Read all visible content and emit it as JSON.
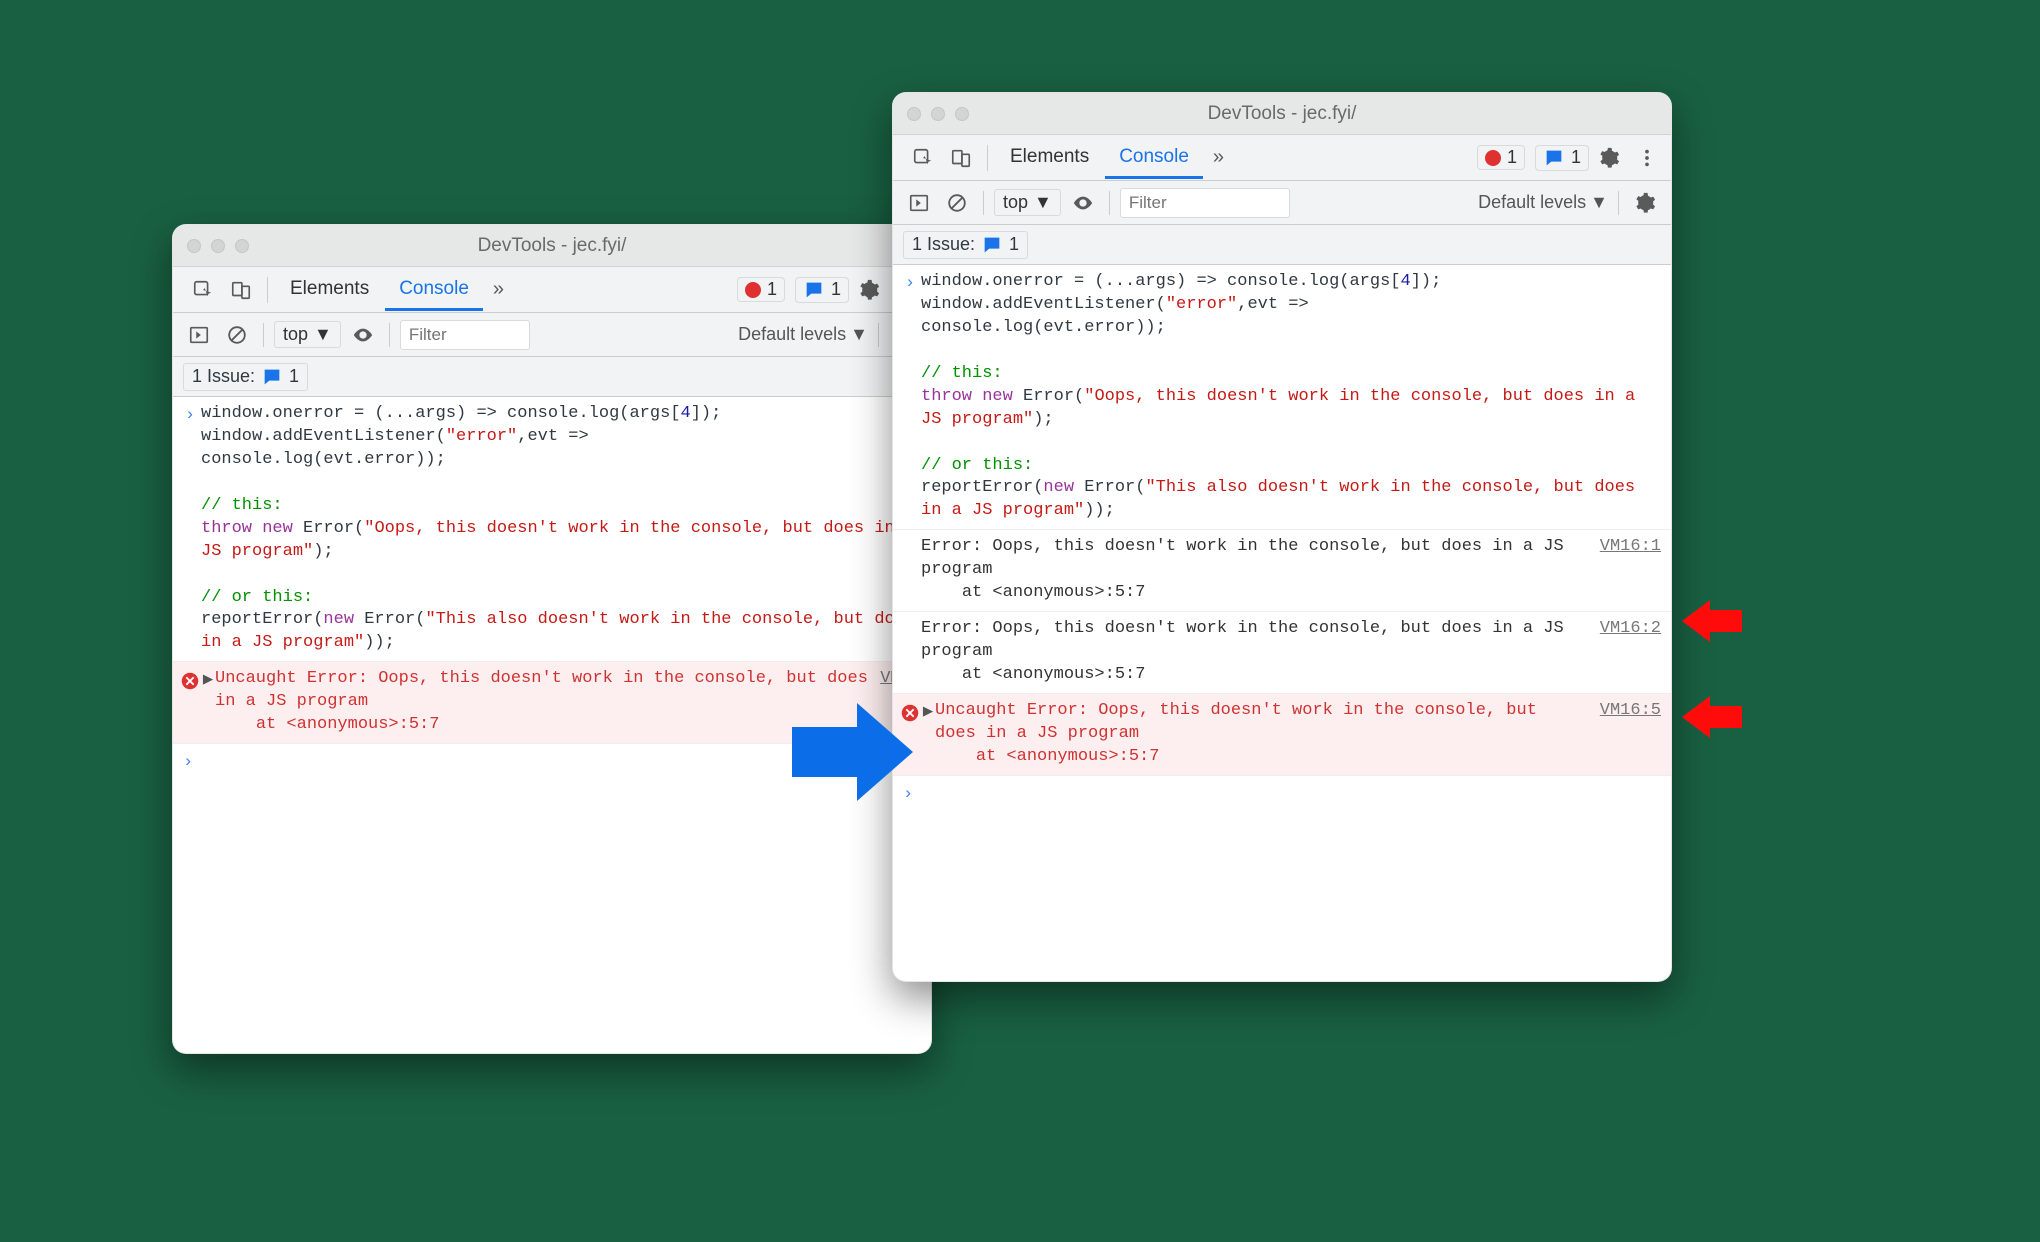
{
  "left": {
    "title": "DevTools - jec.fyi/",
    "tabs": {
      "elements": "Elements",
      "console": "Console"
    },
    "error_count": "1",
    "info_count": "1",
    "toolbar": {
      "context": "top",
      "filter_placeholder": "Filter",
      "levels": "Default levels"
    },
    "issues": {
      "label": "1 Issue:",
      "count": "1"
    },
    "input_code": {
      "l1a": "window.onerror = (...args) => console.log(args[",
      "l1b": "4",
      "l1c": "]);",
      "l2a": "window.addEventListener(",
      "l2b": "\"error\"",
      "l2c": ",evt =>",
      "l3": "console.log(evt.error));",
      "c1": "// this:",
      "l4a": "throw",
      "l4b": " new ",
      "l4c": "Error(",
      "l4d": "\"Oops, this doesn't work in the console, but does in a JS program\"",
      "l4e": ");",
      "c2": "// or this:",
      "l5a": "reportError(",
      "l5b": "new ",
      "l5c": "Error(",
      "l5d": "\"This also doesn't work in the console, but does in a JS program\"",
      "l5e": "));"
    },
    "error1": {
      "text": "Uncaught Error: Oops, this doesn't work in the console, but does in a JS program\n    at <anonymous>:5:7",
      "loc": "VM41"
    }
  },
  "right": {
    "title": "DevTools - jec.fyi/",
    "tabs": {
      "elements": "Elements",
      "console": "Console"
    },
    "error_count": "1",
    "info_count": "1",
    "toolbar": {
      "context": "top",
      "filter_placeholder": "Filter",
      "levels": "Default levels"
    },
    "issues": {
      "label": "1 Issue:",
      "count": "1"
    },
    "input_code": {
      "l1a": "window.onerror = (...args) => console.log(args[",
      "l1b": "4",
      "l1c": "]);",
      "l2a": "window.addEventListener(",
      "l2b": "\"error\"",
      "l2c": ",evt =>",
      "l3": "console.log(evt.error));",
      "c1": "// this:",
      "l4a": "throw",
      "l4b": " new ",
      "l4c": "Error(",
      "l4d": "\"Oops, this doesn't work in the console, but does in a JS program\"",
      "l4e": ");",
      "c2": "// or this:",
      "l5a": "reportError(",
      "l5b": "new ",
      "l5c": "Error(",
      "l5d": "\"This also doesn't work in the console, but does in a JS program\"",
      "l5e": "));"
    },
    "log1": {
      "text": "Error: Oops, this doesn't work in the console, but does in a JS program\n    at <anonymous>:5:7",
      "loc": "VM16:1"
    },
    "log2": {
      "text": "Error: Oops, this doesn't work in the console, but does in a JS program\n    at <anonymous>:5:7",
      "loc": "VM16:2"
    },
    "error1": {
      "text": "Uncaught Error: Oops, this doesn't work in the console, but does in a JS program\n    at <anonymous>:5:7",
      "loc": "VM16:5"
    }
  }
}
